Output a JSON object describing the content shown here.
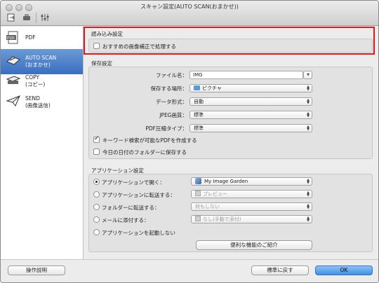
{
  "window": {
    "title": "スキャン設定(AUTO SCAN(おまかせ))"
  },
  "sidebar": {
    "items": [
      {
        "label": "PDF",
        "sublabel": ""
      },
      {
        "label": "AUTO SCAN",
        "sublabel": "(おまかせ)"
      },
      {
        "label": "COPY",
        "sublabel": "(コピー)"
      },
      {
        "label": "SEND",
        "sublabel": "(画像送信)"
      }
    ],
    "selected": "AUTO SCAN"
  },
  "read_settings": {
    "title": "読み込み設定",
    "recommended_correction": {
      "label": "おすすめの画像補正で処理する",
      "checked": false
    }
  },
  "save_settings": {
    "title": "保存設定",
    "file_name": {
      "label": "ファイル名：",
      "value": "IMG"
    },
    "save_location": {
      "label": "保存する場所：",
      "value": "ピクチャ"
    },
    "data_format": {
      "label": "データ形式：",
      "value": "自動"
    },
    "jpeg_quality": {
      "label": "JPEG画質：",
      "value": "標準"
    },
    "pdf_compression": {
      "label": "PDF圧縮タイプ：",
      "value": "標準"
    },
    "keyword_pdf": {
      "label": "キーワード検索が可能なPDFを作成する",
      "checked": true
    },
    "date_folder": {
      "label": "今日の日付のフォルダーに保存する",
      "checked": false
    }
  },
  "app_settings": {
    "title": "アプリケーション設定",
    "options": [
      {
        "label": "アプリケーションで開く：",
        "value": "My Image Garden",
        "selected": true,
        "enabled": true
      },
      {
        "label": "アプリケーションに転送する：",
        "value": "プレビュー",
        "selected": false,
        "enabled": false
      },
      {
        "label": "フォルダーに転送する：",
        "value": "何もしない",
        "selected": false,
        "enabled": false
      },
      {
        "label": "メールに添付する：",
        "value": "なし(手動で添付)",
        "selected": false,
        "enabled": false
      },
      {
        "label": "アプリケーションを起動しない",
        "value": "",
        "selected": false,
        "enabled": true
      }
    ],
    "features_button": "便利な機能のご紹介"
  },
  "footer": {
    "instructions_button": "操作説明",
    "defaults_button": "標準に戻す",
    "ok_button": "OK"
  },
  "colors": {
    "highlight_box": "#e8161b",
    "selected_item": "#3a6fc0",
    "ok_button": "#3d8fe6"
  }
}
